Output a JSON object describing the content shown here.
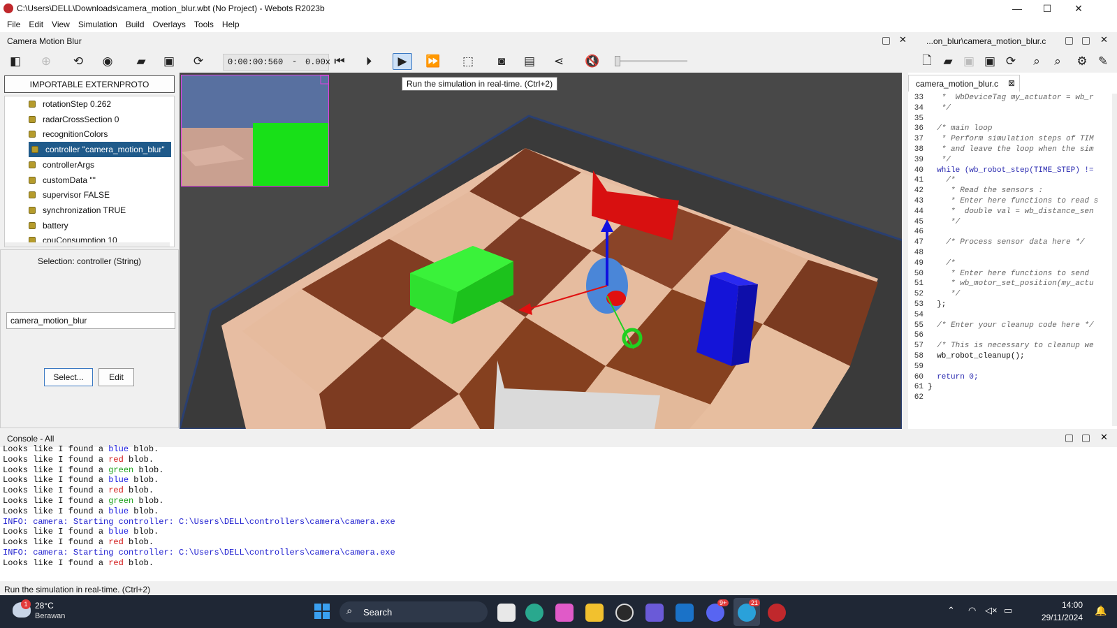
{
  "window": {
    "title": "C:\\Users\\DELL\\Downloads\\camera_motion_blur.wbt (No Project) - Webots R2023b",
    "minimize": "—",
    "maximize": "☐",
    "close": "✕"
  },
  "menu": [
    "File",
    "Edit",
    "View",
    "Simulation",
    "Build",
    "Overlays",
    "Tools",
    "Help"
  ],
  "scene_pane": {
    "title": "Camera Motion Blur"
  },
  "editor_pane": {
    "title": "...on_blur\\camera_motion_blur.c",
    "tab": "camera_motion_blur.c"
  },
  "toolbar": {
    "time": "0:00:00:560",
    "separator": "-",
    "speed": "0.00x",
    "tooltip": "Run the simulation in real-time. (Ctrl+2)"
  },
  "scene_tree": {
    "header_button": "IMPORTABLE EXTERNPROTO",
    "items": [
      {
        "label": "rotationStep 0.262"
      },
      {
        "label": "radarCrossSection 0"
      },
      {
        "label": "recognitionColors"
      },
      {
        "label": "controller \"camera_motion_blur\"",
        "selected": true
      },
      {
        "label": "controllerArgs"
      },
      {
        "label": "customData \"\""
      },
      {
        "label": "supervisor FALSE"
      },
      {
        "label": "synchronization TRUE"
      },
      {
        "label": "battery"
      },
      {
        "label": "cpuConsumption 10"
      }
    ]
  },
  "selection": {
    "label": "Selection: controller (String)",
    "value": "camera_motion_blur",
    "select_button": "Select...",
    "edit_button": "Edit"
  },
  "code_lines": [
    {
      "n": "33",
      "t": "   *  WbDeviceTag my_actuator = wb_r"
    },
    {
      "n": "34",
      "t": "   */"
    },
    {
      "n": "35",
      "t": ""
    },
    {
      "n": "36",
      "t": "  /* main loop"
    },
    {
      "n": "37",
      "t": "   * Perform simulation steps of TIM"
    },
    {
      "n": "38",
      "t": "   * and leave the loop when the sim"
    },
    {
      "n": "39",
      "t": "   */"
    },
    {
      "n": "40",
      "t": "  while (wb_robot_step(TIME_STEP) !="
    },
    {
      "n": "41",
      "t": "    /*"
    },
    {
      "n": "42",
      "t": "     * Read the sensors :"
    },
    {
      "n": "43",
      "t": "     * Enter here functions to read s"
    },
    {
      "n": "44",
      "t": "     *  double val = wb_distance_sen"
    },
    {
      "n": "45",
      "t": "     */"
    },
    {
      "n": "46",
      "t": ""
    },
    {
      "n": "47",
      "t": "    /* Process sensor data here */"
    },
    {
      "n": "48",
      "t": ""
    },
    {
      "n": "49",
      "t": "    /*"
    },
    {
      "n": "50",
      "t": "     * Enter here functions to send"
    },
    {
      "n": "51",
      "t": "     * wb_motor_set_position(my_actu"
    },
    {
      "n": "52",
      "t": "     */"
    },
    {
      "n": "53",
      "t": "  };"
    },
    {
      "n": "54",
      "t": ""
    },
    {
      "n": "55",
      "t": "  /* Enter your cleanup code here */"
    },
    {
      "n": "56",
      "t": ""
    },
    {
      "n": "57",
      "t": "  /* This is necessary to cleanup we"
    },
    {
      "n": "58",
      "t": "  wb_robot_cleanup();"
    },
    {
      "n": "59",
      "t": ""
    },
    {
      "n": "60",
      "t": "  return 0;"
    },
    {
      "n": "61",
      "t": "}"
    },
    {
      "n": "62",
      "t": ""
    }
  ],
  "console": {
    "title": "Console - All",
    "lines": [
      {
        "pre": "Looks like I found a ",
        "color": "blue",
        "post": " blob."
      },
      {
        "pre": "Looks like I found a ",
        "color": "red",
        "post": " blob."
      },
      {
        "pre": "Looks like I found a ",
        "color": "green",
        "post": " blob."
      },
      {
        "pre": "Looks like I found a ",
        "color": "blue",
        "post": " blob."
      },
      {
        "pre": "Looks like I found a ",
        "color": "red",
        "post": " blob."
      },
      {
        "pre": "Looks like I found a ",
        "color": "green",
        "post": " blob."
      },
      {
        "pre": "Looks like I found a ",
        "color": "blue",
        "post": " blob."
      },
      {
        "info": "INFO: camera: Starting controller: C:\\Users\\DELL\\controllers\\camera\\camera.exe"
      },
      {
        "pre": "Looks like I found a ",
        "color": "blue",
        "post": " blob."
      },
      {
        "pre": "Looks like I found a ",
        "color": "red",
        "post": " blob."
      },
      {
        "info": "INFO: camera: Starting controller: C:\\Users\\DELL\\controllers\\camera\\camera.exe"
      },
      {
        "pre": "Looks like I found a ",
        "color": "red",
        "post": " blob."
      }
    ]
  },
  "status": "Run the simulation in real-time. (Ctrl+2)",
  "taskbar": {
    "weather_temp": "28°C",
    "weather_desc": "Berawan",
    "weather_badge": "1",
    "search": "Search",
    "discord_badge": "9+",
    "telegram_badge": "21",
    "time": "14:00",
    "date": "29/11/2024"
  }
}
